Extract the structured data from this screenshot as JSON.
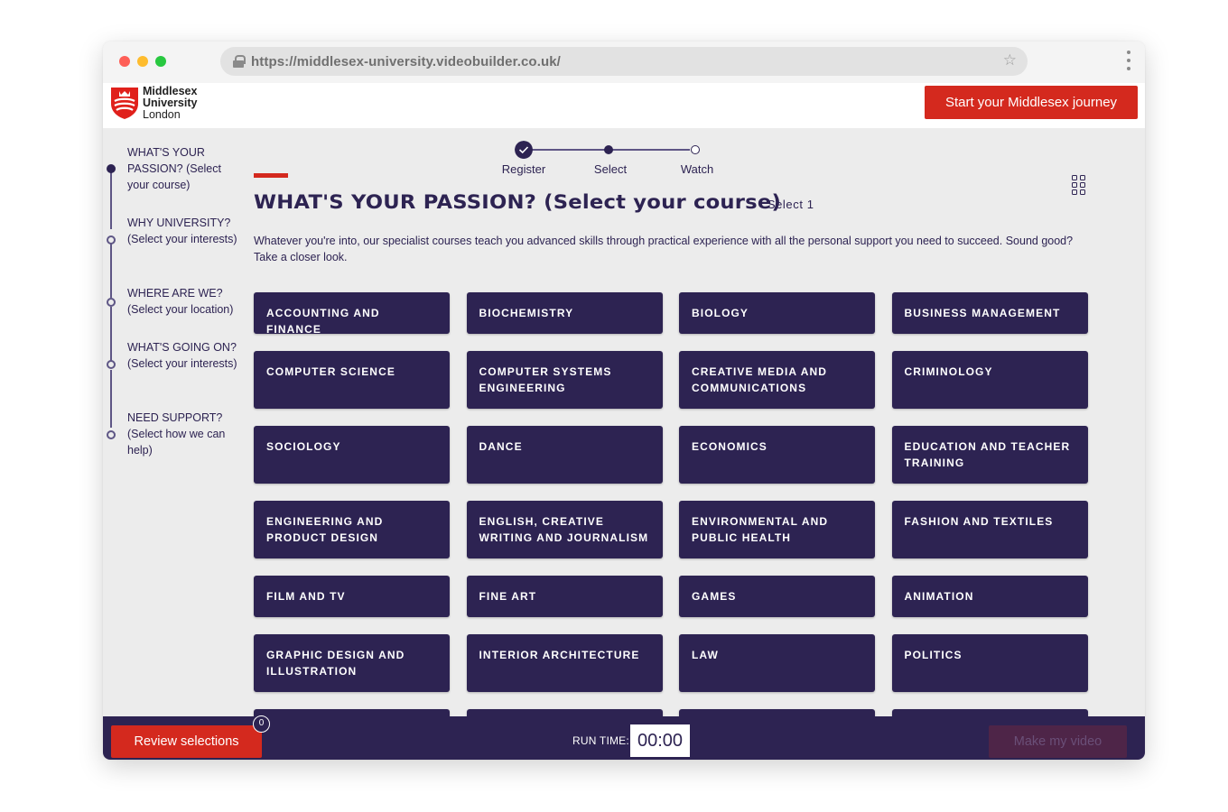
{
  "browser": {
    "url": "https://middlesex-university.videobuilder.co.uk/",
    "icons": {
      "lock": "lock-icon",
      "bookmark": "star-icon",
      "menu": "kebab-menu-icon"
    }
  },
  "header": {
    "logo": {
      "line1": "Middlesex",
      "line2": "University",
      "line3": "London"
    },
    "cta_label": "Start your Middlesex journey"
  },
  "sidebar": {
    "items": [
      {
        "label": "WHAT'S YOUR PASSION? (Select your course)",
        "active": true
      },
      {
        "label": "WHY UNIVERSITY? (Select your interests)",
        "active": false
      },
      {
        "label": "WHERE ARE WE? (Select your location)",
        "active": false
      },
      {
        "label": "WHAT'S GOING ON? (Select your interests)",
        "active": false
      },
      {
        "label": "NEED SUPPORT? (Select how we can help)",
        "active": false
      }
    ]
  },
  "progress": {
    "steps": [
      {
        "label": "Register",
        "state": "done"
      },
      {
        "label": "Select",
        "state": "current"
      },
      {
        "label": "Watch",
        "state": "todo"
      }
    ]
  },
  "main": {
    "title": "WHAT'S YOUR PASSION? (Select your course)",
    "select_hint": "Select 1",
    "intro": "Whatever you're into, our specialist courses teach you advanced skills through practical experience with all the personal support you need to succeed. Sound good? Take a closer look.",
    "view_toggle_icon": "grid-view-icon",
    "courses": [
      "ACCOUNTING AND FINANCE",
      "BIOCHEMISTRY",
      "BIOLOGY",
      "BUSINESS MANAGEMENT",
      "COMPUTER SCIENCE",
      "COMPUTER SYSTEMS ENGINEERING",
      "CREATIVE MEDIA AND COMMUNICATIONS",
      "CRIMINOLOGY",
      "SOCIOLOGY",
      "DANCE",
      "ECONOMICS",
      "EDUCATION AND TEACHER TRAINING",
      "ENGINEERING AND PRODUCT DESIGN",
      "ENGLISH, CREATIVE WRITING AND JOURNALISM",
      "ENVIRONMENTAL AND PUBLIC HEALTH",
      "FASHION AND TEXTILES",
      "FILM AND TV",
      "FINE ART",
      "GAMES",
      "ANIMATION",
      "GRAPHIC DESIGN AND ILLUSTRATION",
      "INTERIOR ARCHITECTURE",
      "LAW",
      "POLITICS"
    ]
  },
  "footer": {
    "review_label": "Review selections",
    "selection_count": "0",
    "run_time_label": "RUN TIME:",
    "run_time_value": "00:00",
    "make_label": "Make my video"
  },
  "colors": {
    "brand_navy": "#2d2352",
    "brand_red": "#d4291e",
    "background": "#ececec"
  }
}
